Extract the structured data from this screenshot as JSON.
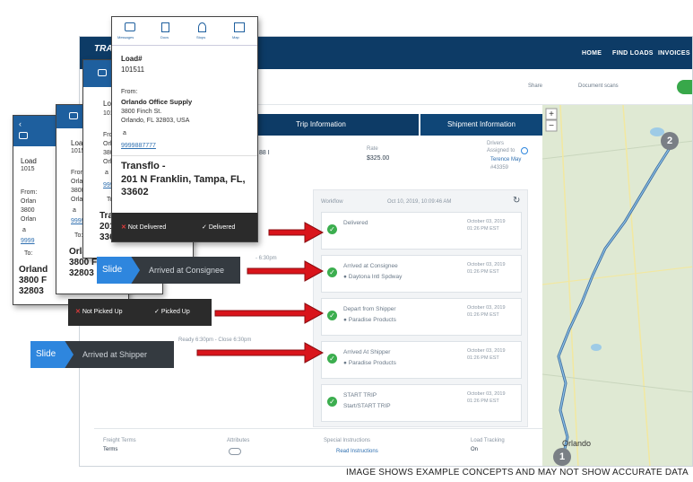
{
  "webapp": {
    "brand": "TRANSFLO",
    "nav": [
      "HOME",
      "FIND LOADS",
      "INVOICES"
    ],
    "subnav": [
      "Share",
      "Document scans"
    ],
    "tabs": [
      "Trip Information",
      "Shipment Information"
    ],
    "rate_label": "Rate",
    "rate_value": "$325.00",
    "drivers_label": "Drivers",
    "drivers_sub": "Assigned to",
    "driver_name": "Terence May",
    "driver_id": "#43359",
    "ref_partial": "88 I",
    "workflow_label": "Workflow",
    "workflow_date": "Oct 10, 2019, 10:09:46 AM",
    "workflow": [
      {
        "title": "Delivered",
        "sub": "",
        "date": "October 03, 2019 01:26 PM EST"
      },
      {
        "title": "Arrived at Consignee",
        "sub": "Daytona Intl Spdway",
        "date": "October 03, 2019 01:26 PM EST"
      },
      {
        "title": "Depart from Shipper",
        "sub": "Paradise Products",
        "date": "October 03, 2019 01:26 PM EST"
      },
      {
        "title": "Arrived At Shipper",
        "sub": "Paradise Products",
        "date": "October 03, 2019 01:26 PM EST"
      },
      {
        "title": "START TRIP",
        "sub": "Start/START TRIP",
        "date": "October 03, 2019 01:26 PM EST"
      }
    ],
    "footer": [
      {
        "label": "Freight Terms",
        "value": "Terms"
      },
      {
        "label": "Attributes",
        "value": ""
      },
      {
        "label": "Special Instructions",
        "value": "Read Instructions"
      },
      {
        "label": "Load Tracking",
        "value": "On"
      }
    ],
    "time_hint_1": "- 6:30pm",
    "time_hint_2": "Ready 6:30pm - Close 6:30pm"
  },
  "phone_front": {
    "tabs": [
      "Messages",
      "Docs",
      "Stops",
      "Map"
    ],
    "load_label": "Load#",
    "load_number": "101511",
    "from_label": "From:",
    "from_name": "Orlando Office Supply",
    "from_addr1": "3800 Finch St.",
    "from_addr2": "Orlando, FL 32803, USA",
    "bullet": "a",
    "phone": "9999887777",
    "to_name": "Transflo -",
    "to_addr": "201 N Franklin, Tampa, FL, 33602",
    "btn_not_delivered": "Not Delivered",
    "btn_delivered": "Delivered"
  },
  "phone_mid": {
    "load_label": "Load",
    "load_number": "1015",
    "from_label": "From:",
    "from_name": "Orla",
    "from_addr1": "3800",
    "from_addr2": "Orlan",
    "bullet": "a",
    "phone": "9999",
    "to_label": "To:",
    "to_name": "Trans",
    "to_addr1": "201 N",
    "to_addr2": "33602",
    "slide_label": "Slide",
    "slide_text": "Arrived at Consignee"
  },
  "phone_back2": {
    "load_label": "Load",
    "load_number": "1015",
    "from_label": "From:",
    "from_name": "Orlan",
    "from_addr1": "3800",
    "from_addr2": "Orlan",
    "bullet": "a",
    "phone": "9999",
    "to_label": "To:",
    "to_name": "Orlan",
    "to_addr1": "3800 F",
    "to_addr2": "32803",
    "btn_not_picked": "Not Picked Up",
    "btn_picked": "Picked Up"
  },
  "phone_back1": {
    "load_label": "Load",
    "load_number": "1015",
    "from_label": "From:",
    "from_name": "Orlan",
    "from_addr1": "3800",
    "from_addr2": "Orlan",
    "bullet": "a",
    "phone": "9999",
    "to_label": "To:",
    "to_name": "Orland",
    "to_addr1": "3800 F",
    "to_addr2": "32803",
    "slide_label": "Slide",
    "slide_text": "Arrived at Shipper"
  },
  "map": {
    "marker_start": "1",
    "marker_end": "2",
    "city": "Orlando"
  },
  "disclaimer": "IMAGE SHOWS EXAMPLE CONCEPTS AND MAY NOT SHOW ACCURATE DATA",
  "colors": {
    "navy": "#0d3b66",
    "accent_blue": "#2e86de",
    "success_green": "#3cae4f",
    "arrow_red": "#d9141b",
    "dark_bar": "#2b2b2b"
  }
}
